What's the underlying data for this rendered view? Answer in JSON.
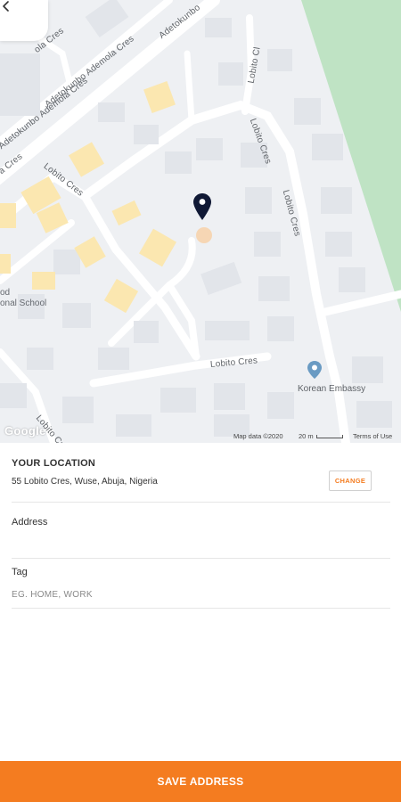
{
  "map": {
    "street_labels": {
      "adetokunbo_1": "Adetokunbo Ademola Cres",
      "adetokunbo_2": "Adetokunbo Ademola Cres",
      "adetokunbo_3": "Adetokunbo",
      "lobito_1": "Lobito Cres",
      "lobito_2": "Lobito Cres",
      "lobito_3": "Lobito Cres",
      "lobito_4": "Lobito Cres",
      "lobito_ci": "Lobito Cl",
      "lobito_5": "Lobito Cres",
      "ola_cres": "ola Cres",
      "a_cres": "a Cres"
    },
    "school_label_1": "od",
    "school_label_2": "onal School",
    "poi_label": "Korean Embassy",
    "google_logo": "Google",
    "map_data": "Map data ©2020",
    "scale": "20 m",
    "terms": "Terms of Use",
    "colors": {
      "park": "#bfe3c4",
      "building": "#e2e5ea",
      "yellow_building": "#fbe7b0",
      "road": "#ffffff",
      "pin": "#101935"
    }
  },
  "form": {
    "location_title": "YOUR LOCATION",
    "location_value": "55 Lobito Cres, Wuse, Abuja, Nigeria",
    "change_label": "CHANGE",
    "address_label": "Address",
    "address_value": "",
    "tag_label": "Tag",
    "tag_placeholder": "EG. HOME, WORK"
  },
  "footer": {
    "save_label": "SAVE ADDRESS"
  },
  "icons": {
    "back": "chevron-left-icon",
    "pin": "map-pin-icon",
    "poi": "poi-pin-icon"
  },
  "colors": {
    "accent": "#f47c20"
  }
}
